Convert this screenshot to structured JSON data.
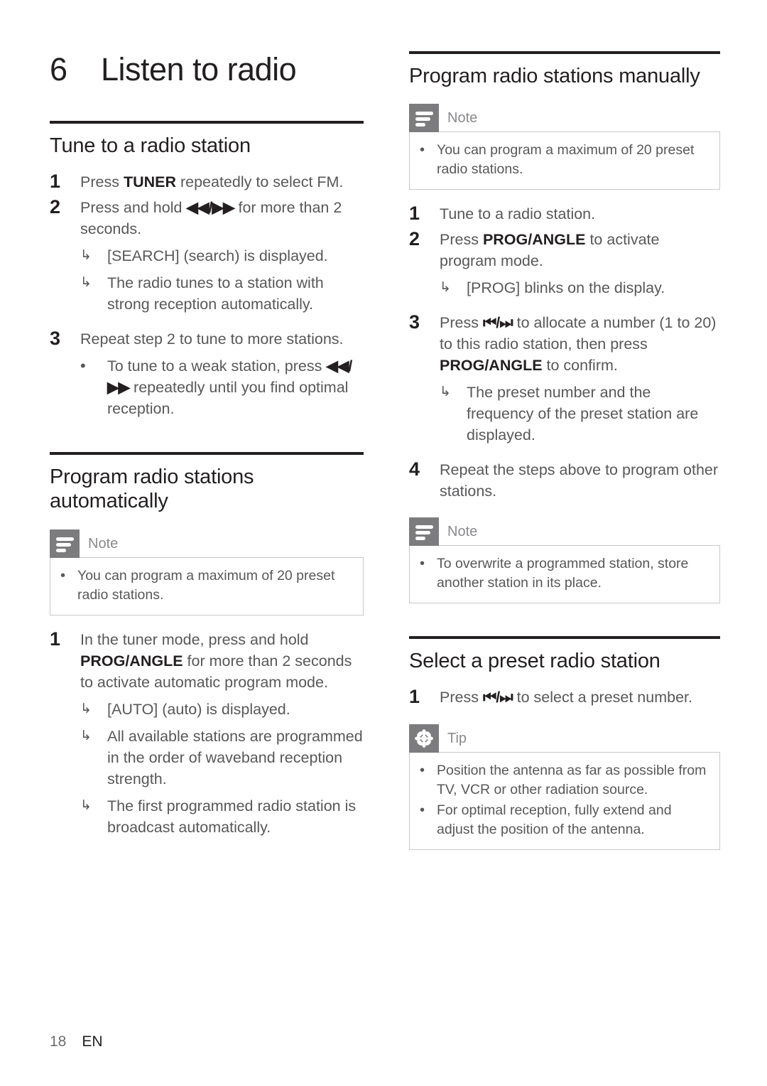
{
  "chapter": {
    "number": "6",
    "title": "Listen to radio"
  },
  "left_column": {
    "section1": {
      "heading": "Tune to a radio station",
      "steps": [
        {
          "num": "1",
          "text_before": "Press ",
          "bold": "TUNER",
          "text_after": " repeatedly to select FM."
        },
        {
          "num": "2",
          "text_before": "Press and hold ",
          "glyph": "◀◀/▶▶",
          "text_after": " for more than 2 seconds.",
          "results": [
            {
              "mark": "↳",
              "text": "[SEARCH] (search) is displayed."
            },
            {
              "mark": "↳",
              "text": "The radio tunes to a station with strong reception automatically."
            }
          ]
        },
        {
          "num": "3",
          "text_before": "Repeat step 2 to tune to more stations.",
          "results": [
            {
              "mark": "•",
              "text_before": "To tune to a weak station, press ",
              "glyph": "◀◀/▶▶",
              "text_after": " repeatedly until you find optimal reception."
            }
          ]
        }
      ]
    },
    "section2": {
      "heading": "Program radio stations automatically",
      "note": {
        "icon": "note-lines-icon",
        "label": "Note",
        "items": [
          "You can program a maximum of 20 preset radio stations."
        ]
      },
      "steps": [
        {
          "num": "1",
          "text_before": "In the tuner mode, press and hold ",
          "bold": "PROG/ANGLE",
          "text_after": " for more than 2 seconds to activate automatic program mode.",
          "results": [
            {
              "mark": "↳",
              "text": "[AUTO] (auto) is displayed."
            },
            {
              "mark": "↳",
              "text": "All available stations are programmed in the order of waveband reception strength."
            },
            {
              "mark": "↳",
              "text": "The first programmed radio station is broadcast automatically."
            }
          ]
        }
      ]
    }
  },
  "right_column": {
    "section1": {
      "heading": "Program radio stations manually",
      "note": {
        "icon": "note-lines-icon",
        "label": "Note",
        "items": [
          "You can program a maximum of 20 preset radio stations."
        ]
      },
      "steps": [
        {
          "num": "1",
          "text_before": "Tune to a radio station."
        },
        {
          "num": "2",
          "text_before": "Press ",
          "bold": "PROG/ANGLE",
          "text_after": " to activate program mode.",
          "results": [
            {
              "mark": "↳",
              "text": "[PROG] blinks on the display."
            }
          ]
        },
        {
          "num": "3",
          "text_before": "Press ",
          "glyph": "⏮/⏭",
          "text_mid": " to allocate a number (1 to 20) to this radio station, then press ",
          "bold": "PROG/ANGLE",
          "text_after": " to confirm.",
          "results": [
            {
              "mark": "↳",
              "text": "The preset number and the frequency of the preset station are displayed."
            }
          ]
        },
        {
          "num": "4",
          "text_before": "Repeat the steps above to program other stations."
        }
      ],
      "note2": {
        "icon": "note-lines-icon",
        "label": "Note",
        "items": [
          "To overwrite a programmed station, store another station in its place."
        ]
      }
    },
    "section2": {
      "heading": "Select a preset radio station",
      "steps": [
        {
          "num": "1",
          "text_before": "Press ",
          "glyph": "⏮/⏭",
          "text_after": " to select a preset number."
        }
      ],
      "tip": {
        "icon": "starburst-icon",
        "label": "Tip",
        "items": [
          "Position the antenna as far as possible from TV, VCR or other radiation source.",
          "For optimal reception, fully extend and adjust the position of the antenna."
        ]
      }
    }
  },
  "footer": {
    "page_number": "18",
    "language": "EN"
  },
  "colors": {
    "ink": "#231f20",
    "body_text": "#58585a",
    "callout_badge": "#7c7c7f",
    "callout_border": "#c9c9cb",
    "callout_label": "#8a8a8d"
  }
}
